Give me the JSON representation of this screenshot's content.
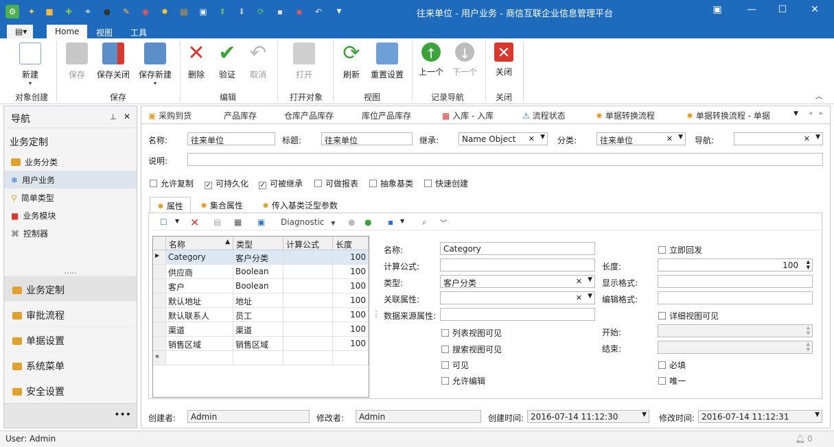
{
  "window": {
    "title": "往来单位 - 用户业务 - 商信互联企业信息管理平台"
  },
  "ribbon_tabs": [
    "Home",
    "视图",
    "工具"
  ],
  "ribbon": {
    "new": "新建",
    "save": "保存",
    "save_close": "保存关闭",
    "save_new": "保存新建",
    "delete": "删除",
    "verify": "验证",
    "cancel": "取消",
    "open": "打开",
    "refresh": "刷新",
    "reset": "重置设置",
    "prev": "上一个",
    "next": "下一个",
    "close": "关闭",
    "groups": [
      "对象创建",
      "保存",
      "编辑",
      "打开对象",
      "视图",
      "记录导航",
      "关闭"
    ]
  },
  "nav": {
    "title": "导航",
    "section": "业务定制",
    "items": [
      "业务分类",
      "用户业务",
      "简单类型",
      "业务模块",
      "控制器"
    ],
    "big": [
      "业务定制",
      "审批流程",
      "单据设置",
      "系统菜单",
      "安全设置"
    ],
    "dots": "....."
  },
  "doc_tabs": [
    "采购到货",
    "产品库存",
    "仓库产品库存",
    "库位产品库存",
    "入库 - 入库",
    "流程状态",
    "单据转换流程",
    "单据转换流程 - 单据"
  ],
  "form": {
    "name_label": "名称:",
    "name": "往来单位",
    "title_label": "标题:",
    "title": "往来单位",
    "inherit_label": "继承:",
    "inherit": "Name Object",
    "category_label": "分类:",
    "category": "往来单位",
    "nav_label": "导航:",
    "nav": "",
    "desc_label": "说明:",
    "desc": "",
    "checks": [
      {
        "label": "允许复制",
        "checked": false
      },
      {
        "label": "可持久化",
        "checked": true
      },
      {
        "label": "可被继承",
        "checked": true
      },
      {
        "label": "可做报表",
        "checked": false
      },
      {
        "label": "抽象基类",
        "checked": false
      },
      {
        "label": "快速创建",
        "checked": false
      }
    ]
  },
  "sub_tabs": [
    "属性",
    "集合属性",
    "传入基类泛型参数"
  ],
  "toolbar": {
    "diagnostic": "Diagnostic"
  },
  "grid": {
    "headers": [
      "名称",
      "类型",
      "计算公式",
      "长度"
    ],
    "rows": [
      [
        "Category",
        "客户分类",
        "",
        "100"
      ],
      [
        "供应商",
        "Boolean",
        "",
        "100"
      ],
      [
        "客户",
        "Boolean",
        "",
        "100"
      ],
      [
        "默认地址",
        "地址",
        "",
        "100"
      ],
      [
        "默认联系人",
        "员工",
        "",
        "100"
      ],
      [
        "渠道",
        "渠道",
        "",
        "100"
      ],
      [
        "销售区域",
        "销售区域",
        "",
        "100"
      ]
    ],
    "new_row_marker": "*"
  },
  "detail": {
    "name_label": "名称:",
    "name": "Category",
    "formula_label": "计算公式:",
    "formula": "",
    "type_label": "类型:",
    "type": "客户分类",
    "rel_label": "关联属性:",
    "rel": "",
    "datasrc_label": "数据来源属性:",
    "datasrc": "",
    "immediate": "立即回发",
    "length_label": "长度:",
    "length": "100",
    "display_label": "显示格式:",
    "display": "",
    "edit_label": "编辑格式:",
    "edit": "",
    "detail_visible": "详细视图可见",
    "start_label": "开始:",
    "end_label": "结束:",
    "list_visible": "列表视图可见",
    "search_visible": "搜索视图可见",
    "visible": "可见",
    "allow_edit": "允许编辑",
    "required": "必填",
    "unique": "唯一"
  },
  "footer": {
    "creator_label": "创建者:",
    "creator": "Admin",
    "modifier_label": "修改者:",
    "modifier": "Admin",
    "ctime_label": "创建时间:",
    "ctime": "2016-07-14 11:12:30",
    "mtime_label": "修改时间:",
    "mtime": "2016-07-14 11:12:31"
  },
  "status": {
    "user": "User: Admin",
    "notifications": "0"
  }
}
